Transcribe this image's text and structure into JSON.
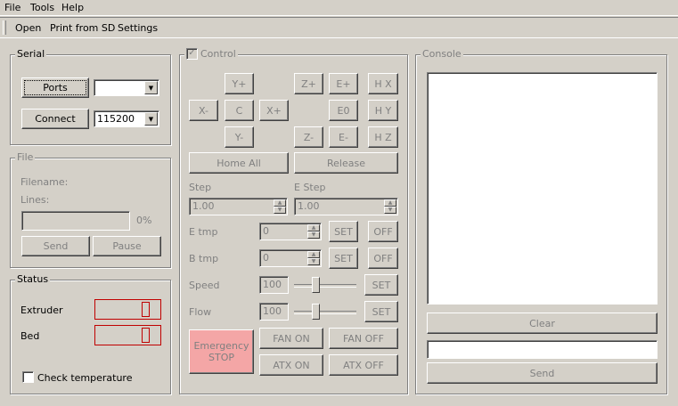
{
  "menubar": {
    "items": [
      "File",
      "Tools",
      "Help"
    ]
  },
  "toolbar": {
    "items": [
      "Open",
      "Print from SD",
      "Settings"
    ]
  },
  "serial": {
    "legend": "Serial",
    "ports_button": "Ports",
    "port_value": "",
    "connect_button": "Connect",
    "baud_value": "115200"
  },
  "file": {
    "legend": "File",
    "filename_label": "Filename:",
    "lines_label": "Lines:",
    "progress_text": "0%",
    "progress_value": 0,
    "send_button": "Send",
    "pause_button": "Pause"
  },
  "status": {
    "legend": "Status",
    "extruder_label": "Extruder",
    "bed_label": "Bed",
    "check_temperature_label": "Check temperature",
    "check_temperature_checked": false
  },
  "control": {
    "legend": "Control",
    "enabled_checked": true,
    "jog": {
      "y_plus": "Y+",
      "x_minus": "X-",
      "center": "C",
      "x_plus": "X+",
      "y_minus": "Y-",
      "z_plus": "Z+",
      "z_minus": "Z-",
      "e_plus": "E+",
      "e0": "E0",
      "e_minus": "E-",
      "home_x": "H X",
      "home_y": "H Y",
      "home_z": "H Z"
    },
    "home_all": "Home All",
    "release": "Release",
    "step_label": "Step",
    "step_value": "1.00",
    "estep_label": "E Step",
    "estep_value": "1.00",
    "etmp_label": "E tmp",
    "etmp_value": "0",
    "btmp_label": "B tmp",
    "btmp_value": "0",
    "set_label": "SET",
    "off_label": "OFF",
    "speed_label": "Speed",
    "speed_value": "100",
    "flow_label": "Flow",
    "flow_value": "100",
    "emergency_stop": "Emergency STOP",
    "fan_on": "FAN ON",
    "fan_off": "FAN OFF",
    "atx_on": "ATX ON",
    "atx_off": "ATX OFF"
  },
  "console": {
    "legend": "Console",
    "output": "",
    "clear_button": "Clear",
    "command_value": "",
    "send_button": "Send"
  }
}
